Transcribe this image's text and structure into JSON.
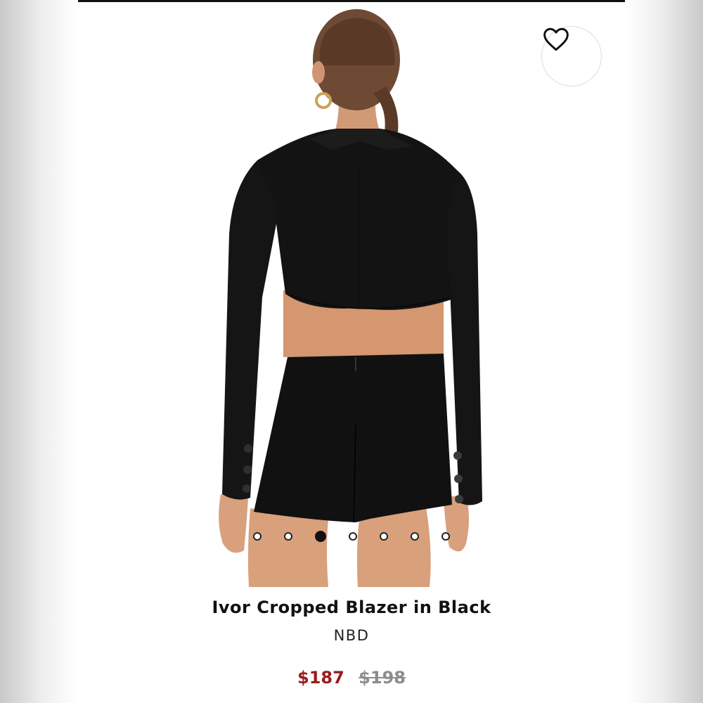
{
  "product": {
    "title": "Ivor Cropped Blazer in Black",
    "brand": "NBD",
    "sale_price": "$187",
    "original_price": "$198"
  },
  "gallery": {
    "image_description_icon": "product-photo",
    "total_images": 7,
    "active_index": 2
  },
  "actions": {
    "favorite_icon": "heart-icon"
  },
  "colors": {
    "sale_price": "#9b1c1c",
    "original_price": "#8c8c8c",
    "text": "#111111"
  }
}
